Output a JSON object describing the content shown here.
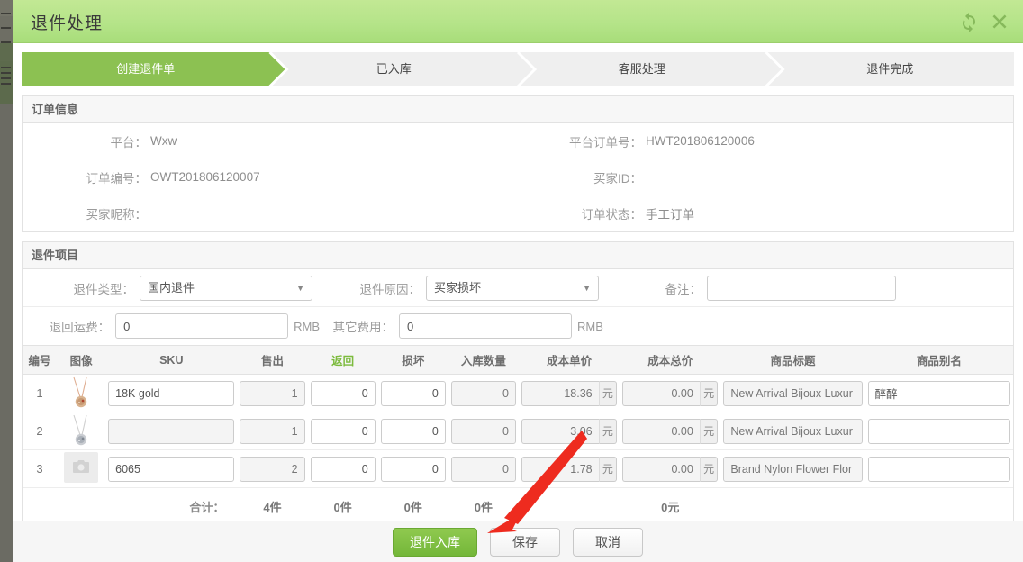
{
  "window": {
    "title": "退件处理",
    "refresh_icon": "refresh-icon",
    "close_icon": "close-icon",
    "accent_green": "#8cc152",
    "header_green": "#b5e489"
  },
  "steps": [
    {
      "label": "创建退件单",
      "active": true
    },
    {
      "label": "已入库",
      "active": false
    },
    {
      "label": "客服处理",
      "active": false
    },
    {
      "label": "退件完成",
      "active": false
    }
  ],
  "order_info": {
    "section_title": "订单信息",
    "rows": [
      [
        {
          "label": "平台：",
          "value": "Wxw"
        },
        {
          "label": "平台订单号：",
          "value": "HWT201806120006"
        }
      ],
      [
        {
          "label": "订单编号：",
          "value": "OWT201806120007"
        },
        {
          "label": "买家ID：",
          "value": ""
        }
      ],
      [
        {
          "label": "买家昵称：",
          "value": ""
        },
        {
          "label": "订单状态：",
          "value": "手工订单"
        }
      ]
    ]
  },
  "return_items": {
    "section_title": "退件项目",
    "return_type": {
      "label": "退件类型：",
      "value": "国内退件"
    },
    "return_reason": {
      "label": "退件原因：",
      "value": "买家损坏"
    },
    "remark": {
      "label": "备注：",
      "value": "",
      "placeholder": ""
    },
    "return_freight": {
      "label": "退回运费：",
      "value": "0",
      "unit": "RMB"
    },
    "other_fee": {
      "label": "其它费用：",
      "value": "0",
      "unit": "RMB"
    }
  },
  "items_table": {
    "columns": [
      {
        "key": "no",
        "label": "编号",
        "highlight": false
      },
      {
        "key": "image",
        "label": "图像",
        "highlight": false
      },
      {
        "key": "sku",
        "label": "SKU",
        "highlight": false
      },
      {
        "key": "sold",
        "label": "售出",
        "highlight": false
      },
      {
        "key": "returned",
        "label": "返回",
        "highlight": true
      },
      {
        "key": "damaged",
        "label": "损坏",
        "highlight": false
      },
      {
        "key": "instock",
        "label": "入库数量",
        "highlight": false
      },
      {
        "key": "unit_cost",
        "label": "成本单价",
        "highlight": false
      },
      {
        "key": "total_cost",
        "label": "成本总价",
        "highlight": false
      },
      {
        "key": "title",
        "label": "商品标题",
        "highlight": false
      },
      {
        "key": "alias",
        "label": "商品别名",
        "highlight": false
      }
    ],
    "currency_suffix": "元",
    "rows": [
      {
        "no": "1",
        "image": "necklace-rose-gold-thumb",
        "sku": "18K gold",
        "sold": "1",
        "returned": "0",
        "damaged": "0",
        "instock": "0",
        "unit_cost": "18.36",
        "total_cost": "0.00",
        "title": "New Arrival Bijoux Luxur",
        "alias": "醉醉"
      },
      {
        "no": "2",
        "image": "necklace-silver-thumb",
        "sku": "",
        "sold": "1",
        "returned": "0",
        "damaged": "0",
        "instock": "0",
        "unit_cost": "3.06",
        "total_cost": "0.00",
        "title": "New Arrival Bijoux Luxur",
        "alias": ""
      },
      {
        "no": "3",
        "image": "image-placeholder-thumb",
        "sku": "6065",
        "sold": "2",
        "returned": "0",
        "damaged": "0",
        "instock": "0",
        "unit_cost": "1.78",
        "total_cost": "0.00",
        "title": "Brand Nylon Flower Flor",
        "alias": ""
      }
    ],
    "totals": {
      "label": "合计：",
      "sold": "4件",
      "returned": "0件",
      "damaged": "0件",
      "instock": "0件",
      "total_cost": "0元"
    }
  },
  "footer": {
    "buttons": [
      {
        "label": "退件入库",
        "style": "primary",
        "name": "return-to-stock-button"
      },
      {
        "label": "保存",
        "style": "default",
        "name": "save-button"
      },
      {
        "label": "取消",
        "style": "default",
        "name": "cancel-button"
      }
    ]
  },
  "annotation": {
    "arrow_color": "#ee2b1f",
    "target": "save-button"
  }
}
